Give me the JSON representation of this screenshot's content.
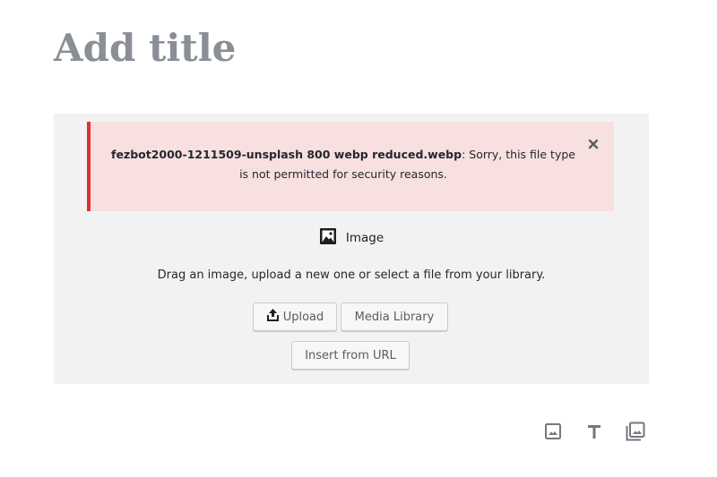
{
  "editor": {
    "title_placeholder": "Add title"
  },
  "image_block": {
    "label": "Image",
    "instructions": "Drag an image, upload a new one or select a file from your library.",
    "error_notice": {
      "file_name": "fezbot2000-1211509-unsplash 800 webp reduced.webp",
      "message": ": Sorry, this file type is not permitted for security reasons.",
      "close_icon": "close-icon"
    },
    "buttons": {
      "upload": "Upload",
      "media_library": "Media Library",
      "insert_url": "Insert from URL"
    },
    "icons": {
      "block_icon": "image-icon",
      "upload_icon": "upload-icon"
    }
  },
  "inserter_shortcuts": {
    "items": [
      {
        "icon": "image-icon",
        "label": "Image"
      },
      {
        "icon": "text-icon",
        "label": "Paragraph"
      },
      {
        "icon": "gallery-icon",
        "label": "Gallery"
      }
    ]
  },
  "colors": {
    "title": "#8a8f95",
    "notice_bg": "#f8e0e0",
    "notice_border": "#dc3232",
    "placeholder_bg": "#f2f2f2"
  }
}
